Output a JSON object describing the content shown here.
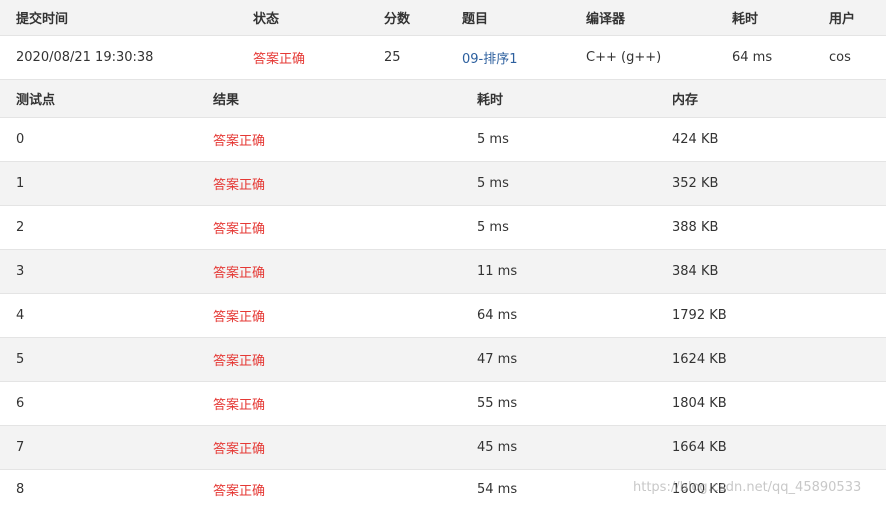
{
  "summary": {
    "headers": [
      "提交时间",
      "状态",
      "分数",
      "题目",
      "编译器",
      "耗时",
      "用户"
    ],
    "row": {
      "time": "2020/08/21 19:30:38",
      "status": "答案正确",
      "score": "25",
      "problem": "09-排序1",
      "compiler": "C++ (g++)",
      "elapsed": "64 ms",
      "user": "cos"
    }
  },
  "tests": {
    "headers": [
      "测试点",
      "结果",
      "耗时",
      "内存"
    ],
    "rows": [
      {
        "id": "0",
        "result": "答案正确",
        "time": "5 ms",
        "memory": "424 KB"
      },
      {
        "id": "1",
        "result": "答案正确",
        "time": "5 ms",
        "memory": "352 KB"
      },
      {
        "id": "2",
        "result": "答案正确",
        "time": "5 ms",
        "memory": "388 KB"
      },
      {
        "id": "3",
        "result": "答案正确",
        "time": "11 ms",
        "memory": "384 KB"
      },
      {
        "id": "4",
        "result": "答案正确",
        "time": "64 ms",
        "memory": "1792 KB"
      },
      {
        "id": "5",
        "result": "答案正确",
        "time": "47 ms",
        "memory": "1624 KB"
      },
      {
        "id": "6",
        "result": "答案正确",
        "time": "55 ms",
        "memory": "1804 KB"
      },
      {
        "id": "7",
        "result": "答案正确",
        "time": "45 ms",
        "memory": "1664 KB"
      },
      {
        "id": "8",
        "result": "答案正确",
        "time": "54 ms",
        "memory": "1600 KB"
      }
    ]
  },
  "watermark": "https://blog.csdn.net/qq_45890533",
  "colors": {
    "accepted": "#e53935",
    "link": "#2c5f9e",
    "header_bg": "#f3f3f3",
    "border": "#e4e4e4"
  }
}
